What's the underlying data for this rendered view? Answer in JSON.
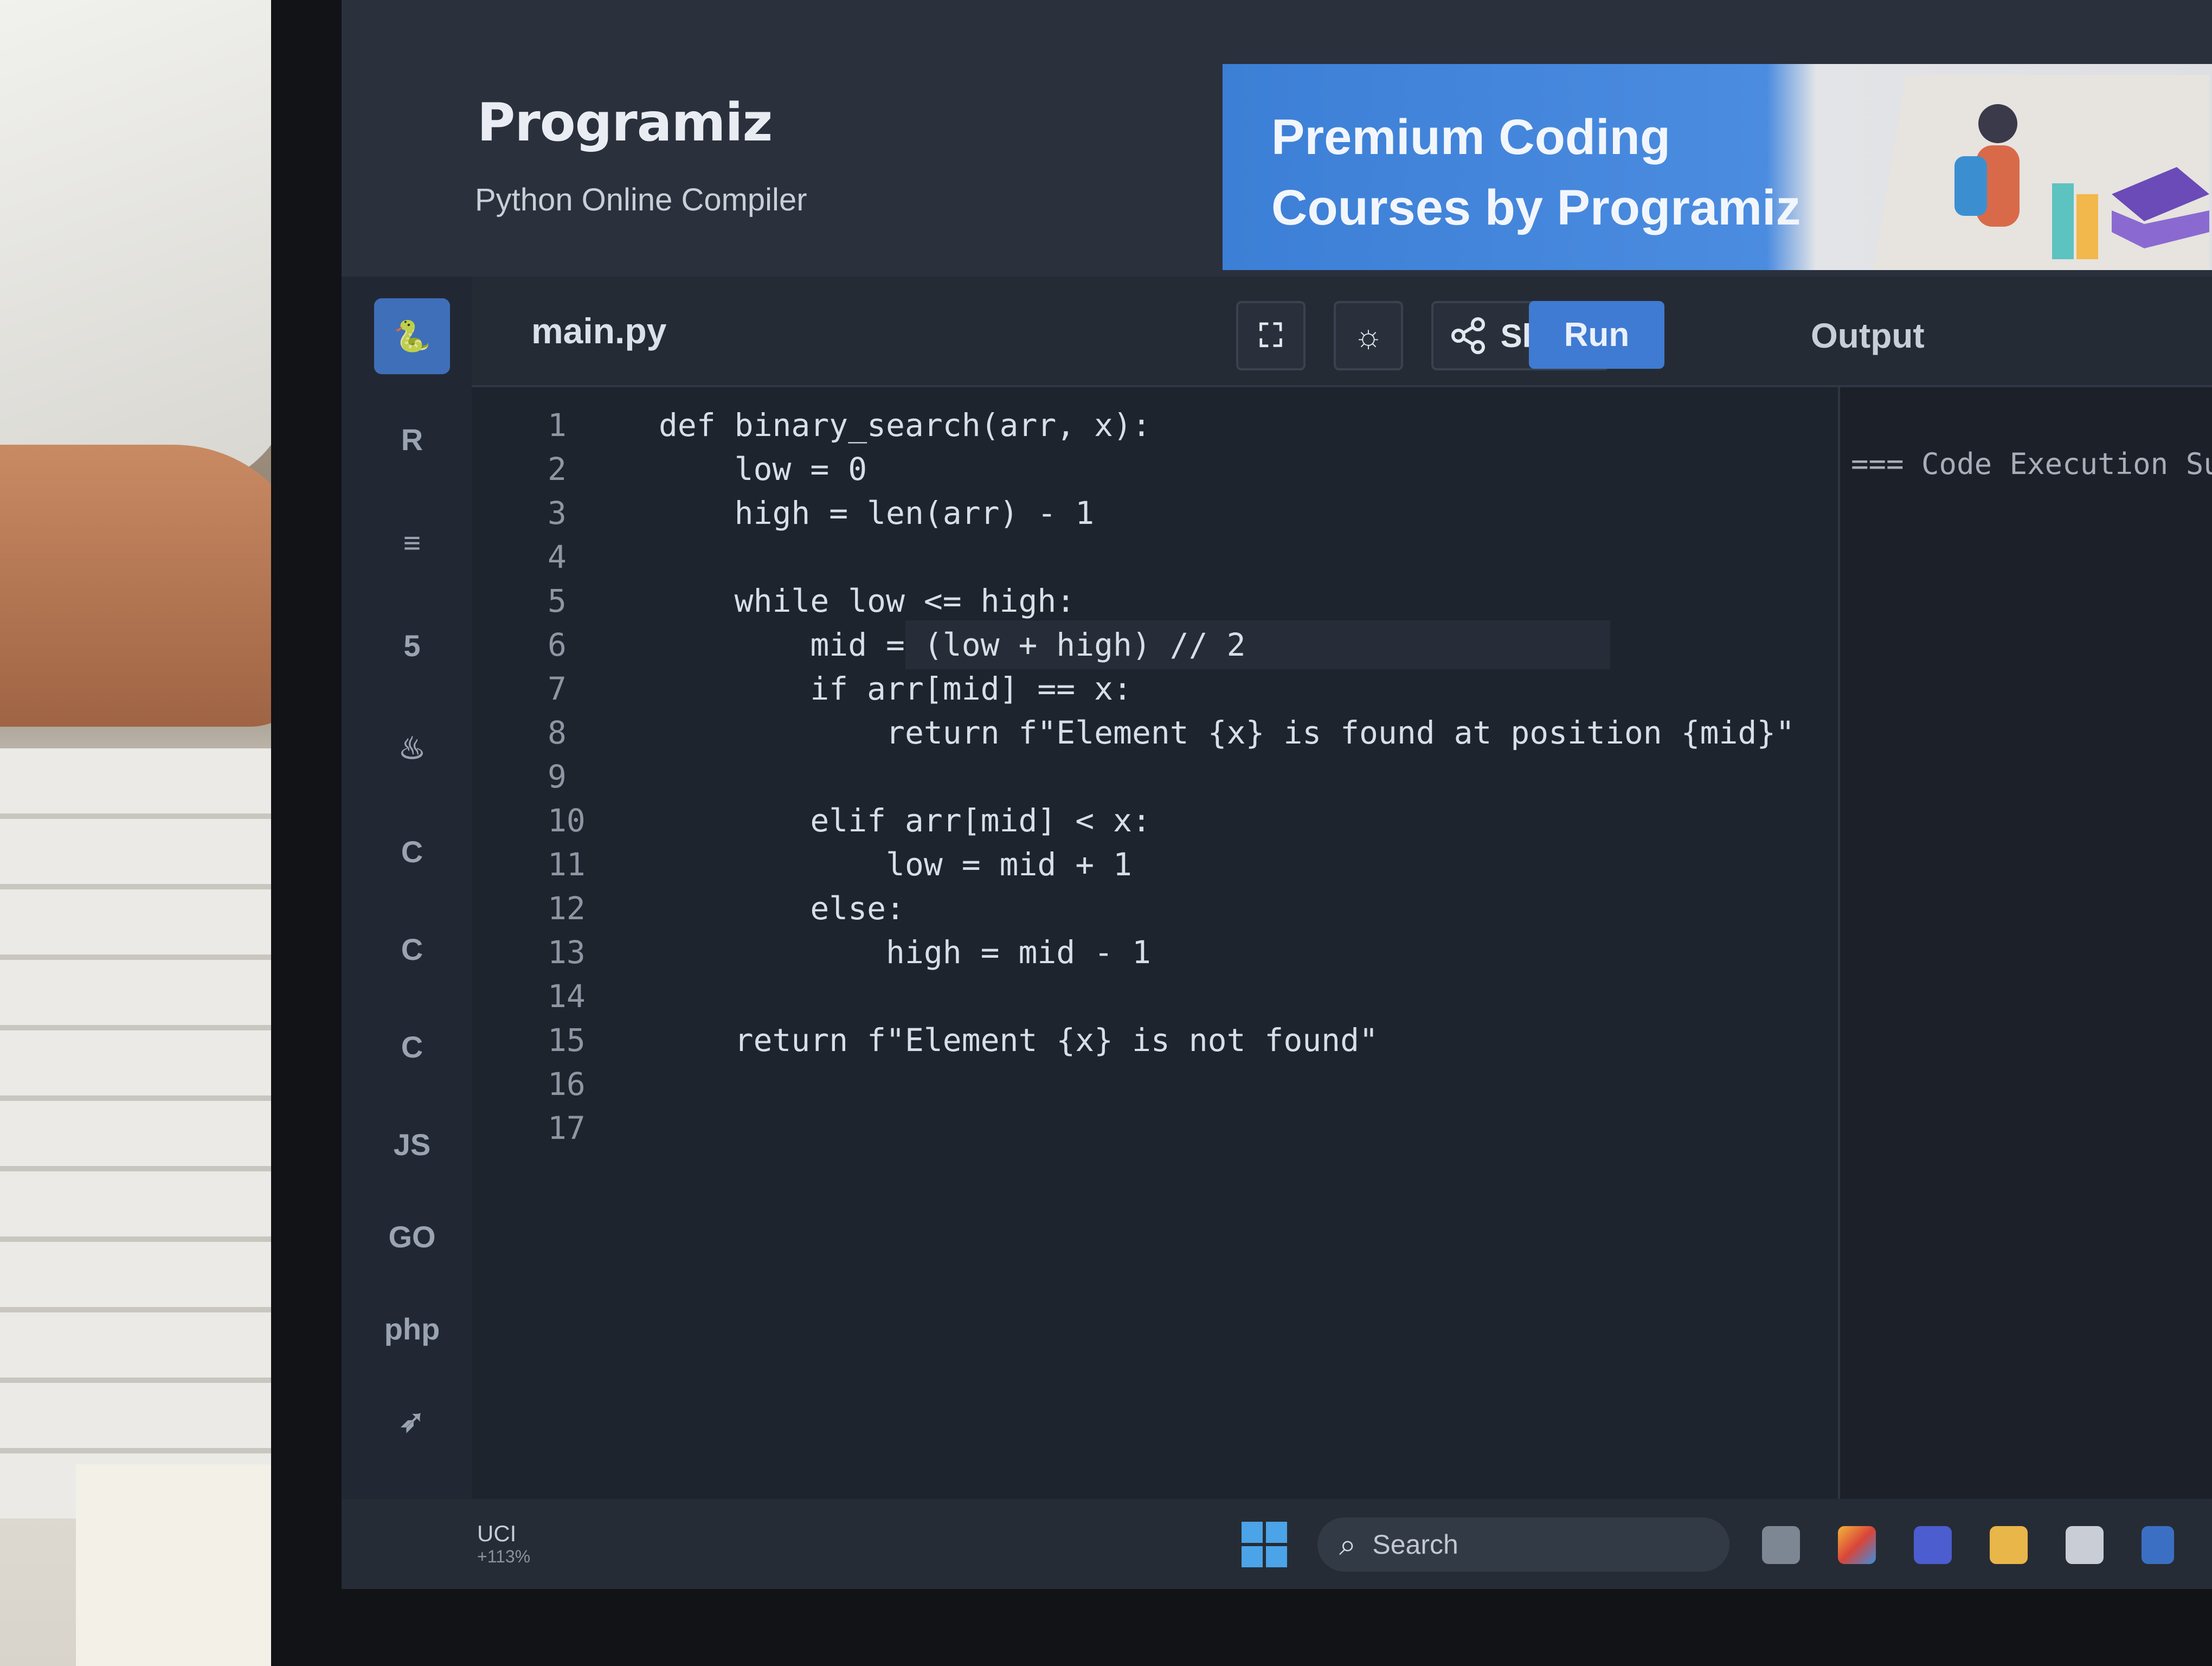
{
  "header": {
    "brand": "Programiz",
    "subtitle": "Python Online Compiler",
    "banner_line1": "Premium Coding",
    "banner_line2": "Courses by Programiz"
  },
  "sidebar": {
    "items": [
      {
        "name": "python",
        "label": "🐍"
      },
      {
        "name": "r",
        "label": "R"
      },
      {
        "name": "sql",
        "label": "≡"
      },
      {
        "name": "html",
        "label": "5"
      },
      {
        "name": "java",
        "label": "♨"
      },
      {
        "name": "c",
        "label": "C"
      },
      {
        "name": "cpp",
        "label": "C"
      },
      {
        "name": "csharp",
        "label": "C"
      },
      {
        "name": "js",
        "label": "JS"
      },
      {
        "name": "go",
        "label": "GO"
      },
      {
        "name": "php",
        "label": "php"
      },
      {
        "name": "swift",
        "label": "➶"
      }
    ]
  },
  "toolbar": {
    "file_tab": "main.py",
    "fullscreen_icon": "⛶",
    "theme_icon": "☼",
    "share_label": "Share",
    "run_label": "Run",
    "output_label": "Output"
  },
  "editor": {
    "lines": [
      {
        "n": "1",
        "t": "def binary_search(arr, x):"
      },
      {
        "n": "2",
        "t": "    low = 0"
      },
      {
        "n": "3",
        "t": "    high = len(arr) - 1"
      },
      {
        "n": "4",
        "t": ""
      },
      {
        "n": "5",
        "t": "    while low <= high:"
      },
      {
        "n": "6",
        "t": "        mid = (low + high) // 2"
      },
      {
        "n": "7",
        "t": "        if arr[mid] == x:"
      },
      {
        "n": "8",
        "t": "            return f\"Element {x} is found at position {mid}\""
      },
      {
        "n": "9",
        "t": ""
      },
      {
        "n": "10",
        "t": "        elif arr[mid] < x:"
      },
      {
        "n": "11",
        "t": "            low = mid + 1"
      },
      {
        "n": "12",
        "t": "        else:"
      },
      {
        "n": "13",
        "t": "            high = mid - 1"
      },
      {
        "n": "14",
        "t": ""
      },
      {
        "n": "15",
        "t": "    return f\"Element {x} is not found\""
      },
      {
        "n": "16",
        "t": ""
      },
      {
        "n": "17",
        "t": ""
      }
    ]
  },
  "output": {
    "text": "=== Code Execution Su"
  },
  "taskbar": {
    "weather_label": "UCI",
    "weather_change": "+113%",
    "search_label": "Search"
  },
  "colors": {
    "accent": "#3f7bd2",
    "editor_bg": "#1e242e",
    "header_bg": "#2a313d"
  }
}
